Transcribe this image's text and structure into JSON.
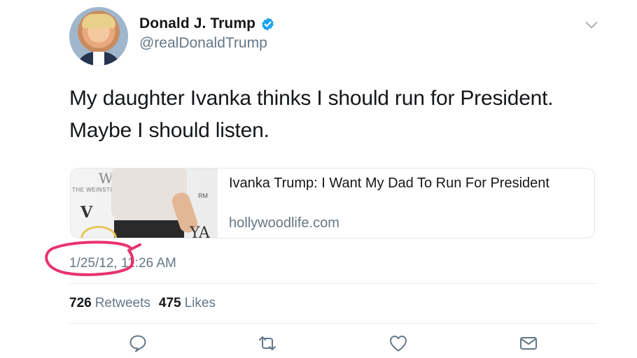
{
  "user": {
    "display_name": "Donald J. Trump",
    "handle": "@realDonaldTrump",
    "verified": true
  },
  "tweet": {
    "text_line1": "My daughter Ivanka thinks I should run for President.",
    "text_line2": "Maybe I should listen.",
    "timestamp": "1/25/12, 11:26 AM"
  },
  "card": {
    "title": "Ivanka Trump: I Want My Dad To Run For President",
    "domain": "hollywoodlife.com",
    "thumb_text": {
      "brand": "THE WEINSTEIN",
      "mark": "W",
      "logo": "V",
      "fragment": "RM",
      "backdrop": "YA"
    }
  },
  "stats": {
    "retweets_count": "726",
    "retweets_label": "Retweets",
    "likes_count": "475",
    "likes_label": "Likes"
  },
  "icons": [
    "chevron-down-icon",
    "verified-badge-icon",
    "reply-icon",
    "retweet-icon",
    "like-icon",
    "direct-message-icon"
  ],
  "colors": {
    "text": "#14171a",
    "secondary": "#657786",
    "verified": "#1da1f2",
    "annotation": "#e8336e",
    "divider": "#e1e8ed"
  }
}
